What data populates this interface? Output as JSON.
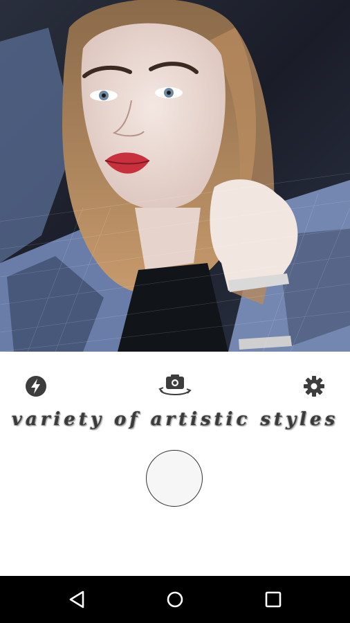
{
  "colors": {
    "controls_background": "#ffffff",
    "icon_color": "#3d3d3d",
    "navbar_background": "#000000",
    "nav_icon_color": "#ffffff"
  },
  "photo": {
    "description_icon": "stylized-portrait-image"
  },
  "controls": {
    "flash_icon": "flash-icon",
    "switch_camera_icon": "switch-camera-icon",
    "settings_icon": "gear-icon",
    "tagline": "variety of artistic styles",
    "shutter_icon": "shutter-button"
  },
  "navbar": {
    "back_icon": "back-triangle-icon",
    "home_icon": "home-circle-icon",
    "recent_icon": "recent-apps-square-icon"
  }
}
